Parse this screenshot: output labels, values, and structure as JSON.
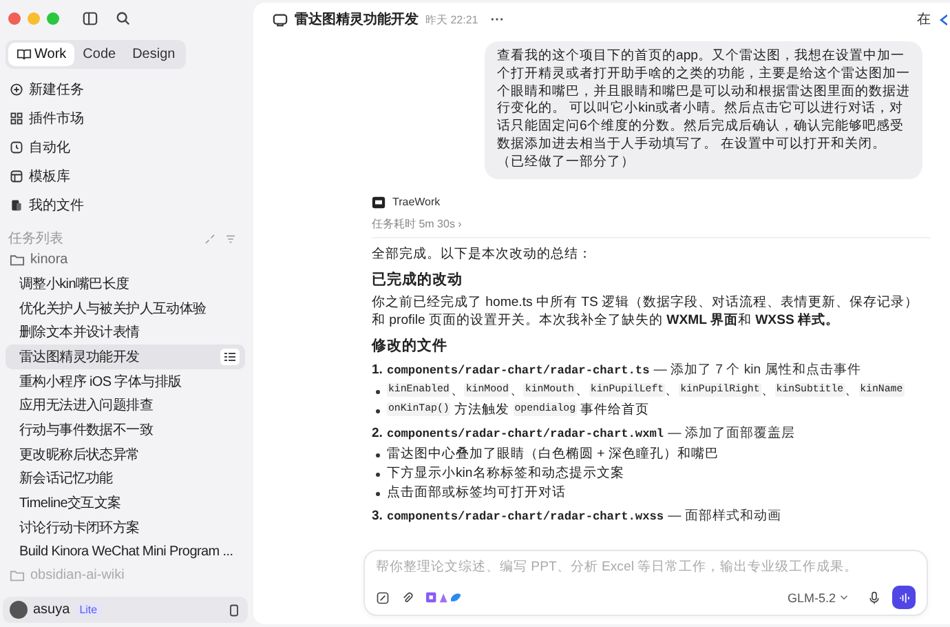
{
  "sidebar": {
    "mode_tabs": [
      {
        "label": "Work",
        "selected": true
      },
      {
        "label": "Code",
        "selected": false
      },
      {
        "label": "Design",
        "selected": false
      }
    ],
    "nav": [
      {
        "kind": "new",
        "label": "新建任务"
      },
      {
        "kind": "plugin",
        "label": "插件市场"
      },
      {
        "kind": "auto",
        "label": "自动化"
      },
      {
        "kind": "template",
        "label": "模板库"
      },
      {
        "kind": "files",
        "label": "我的文件"
      }
    ],
    "task_list_label": "任务列表",
    "folders": [
      {
        "name": "kinora",
        "expanded": true,
        "children": [
          {
            "label": "调整小kin嘴巴长度",
            "selected": false
          },
          {
            "label": "优化关护人与被关护人互动体验",
            "selected": false
          },
          {
            "label": "删除文本并设计表情",
            "selected": false
          },
          {
            "label": "雷达图精灵功能开发",
            "selected": true
          },
          {
            "label": "重构小程序 iOS 字体与排版",
            "selected": false
          },
          {
            "label": "应用无法进入问题排查",
            "selected": false
          },
          {
            "label": "行动与事件数据不一致",
            "selected": false
          },
          {
            "label": "更改昵称后状态异常",
            "selected": false
          },
          {
            "label": "新会话记忆功能",
            "selected": false
          },
          {
            "label": "Timeline交互文案",
            "selected": false
          },
          {
            "label": "讨论行动卡闭环方案",
            "selected": false
          },
          {
            "label": "Build Kinora WeChat Mini Program ...",
            "selected": false
          }
        ]
      },
      {
        "name": "obsidian-ai-wiki",
        "expanded": false
      }
    ],
    "user": {
      "name": "asuya",
      "badge": "Lite"
    }
  },
  "chat": {
    "title": "雷达图精灵功能开发",
    "time": "昨天 22:21",
    "edge_text": "在",
    "user_message": "查看我的这个项目下的首页的app。又个雷达图，我想在设置中加一个打开精灵或者打开助手啥的之类的功能，主要是给这个雷达图加一个眼睛和嘴巴，并且眼睛和嘴巴是可以动和根据雷达图里面的数据进行变化的。 可以叫它小kin或者小晴。然后点击它可以进行对话，对话只能固定问6个维度的分数。然后完成后确认，确认完能够吧感受数据添加进去相当于人手动填写了。 在设置中可以打开和关闭。（已经做了一部分了）",
    "assistant": {
      "name": "TraeWork",
      "duration": "任务耗时 5m 30s ›",
      "blocks": [
        {
          "kind": "p",
          "text": "全部完成。以下是本次改动的总结："
        },
        {
          "kind": "h",
          "text": "已完成的改动"
        },
        {
          "kind": "p",
          "text": "你之前已经完成了 home.ts 中所有 TS 逻辑（数据字段、对话流程、表情更新、保存记录）和 profile 页面的设置开关。本次我补全了缺失的 **WXML 界面**和 **WXSS 样式。**"
        },
        {
          "kind": "h",
          "text": "修改的文件"
        },
        {
          "kind": "file",
          "number": "1.",
          "path": "components/radar-chart/radar-chart.ts",
          "note": "— 添加了 7 个 kin 属性和点击事件"
        },
        {
          "kind": "bullet",
          "parts": [
            {
              "code": true,
              "text": "kinEnabled"
            },
            {
              "code": false,
              "text": "、"
            },
            {
              "code": true,
              "text": "kinMood"
            },
            {
              "code": false,
              "text": "、"
            },
            {
              "code": true,
              "text": "kinMouth"
            },
            {
              "code": false,
              "text": "、"
            },
            {
              "code": true,
              "text": "kinPupilLeft"
            },
            {
              "code": false,
              "text": "、"
            },
            {
              "code": true,
              "text": "kinPupilRight"
            },
            {
              "code": false,
              "text": "、"
            },
            {
              "code": true,
              "text": "kinSubtitle"
            },
            {
              "code": false,
              "text": "、"
            },
            {
              "code": true,
              "text": "kinName"
            }
          ]
        },
        {
          "kind": "bullet",
          "parts": [
            {
              "code": true,
              "text": "onKinTap()"
            },
            {
              "code": false,
              "text": " 方法触发 "
            },
            {
              "code": true,
              "text": "opendialog"
            },
            {
              "code": false,
              "text": " 事件给首页"
            }
          ]
        },
        {
          "kind": "file",
          "number": "2.",
          "path": "components/radar-chart/radar-chart.wxml",
          "note": "— 添加了面部覆盖层"
        },
        {
          "kind": "bullet",
          "parts": [
            {
              "code": false,
              "text": "雷达图中心叠加了眼睛（白色椭圆 + 深色瞳孔）和嘴巴"
            }
          ]
        },
        {
          "kind": "bullet",
          "parts": [
            {
              "code": false,
              "text": "下方显示小kin名称标签和动态提示文案"
            }
          ]
        },
        {
          "kind": "bullet",
          "parts": [
            {
              "code": false,
              "text": "点击面部或标签均可打开对话"
            }
          ]
        },
        {
          "kind": "file",
          "number": "3.",
          "path": "components/radar-chart/radar-chart.wxss",
          "note": "— 面部样式和动画"
        }
      ]
    }
  },
  "composer": {
    "placeholder": "帮你整理论文综述、编写 PPT、分析 Excel 等日常工作，输出专业级工作成果。",
    "model": "GLM-5.2"
  }
}
